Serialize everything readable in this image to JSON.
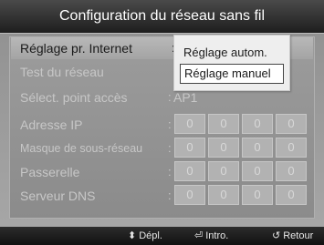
{
  "title": "Configuration du réseau sans fil",
  "rows": {
    "network_setting": {
      "label": "Réglage pr. Internet",
      "separator": ":"
    },
    "network_test": {
      "label": "Test du réseau"
    },
    "access_point": {
      "label": "Sélect. point accès",
      "separator": ":",
      "value": "AP1"
    },
    "ip_address": {
      "label": "Adresse IP",
      "separator": ":",
      "octets": [
        "0",
        "0",
        "0",
        "0"
      ]
    },
    "subnet_mask": {
      "label": "Masque de sous-réseau",
      "separator": ":",
      "octets": [
        "0",
        "0",
        "0",
        "0"
      ]
    },
    "gateway": {
      "label": "Passerelle",
      "separator": ":",
      "octets": [
        "0",
        "0",
        "0",
        "0"
      ]
    },
    "dns_server": {
      "label": "Serveur DNS",
      "separator": ":",
      "octets": [
        "0",
        "0",
        "0",
        "0"
      ]
    }
  },
  "dropdown": {
    "options": [
      "Réglage autom.",
      "Réglage manuel"
    ],
    "selected": "Réglage manuel"
  },
  "footer": {
    "move": {
      "icon": "up-down-arrows-icon",
      "glyph": "⬍",
      "label": "Dépl."
    },
    "enter": {
      "icon": "enter-icon",
      "glyph": "⏎",
      "label": "Intro."
    },
    "return": {
      "icon": "return-icon",
      "glyph": "↺",
      "label": "Retour"
    }
  },
  "colors": {
    "title_bar": "#1e1e1e",
    "panel": "#9c9c9c",
    "dropdown_bg": "#eeeeee",
    "selected_border": "#444444"
  }
}
